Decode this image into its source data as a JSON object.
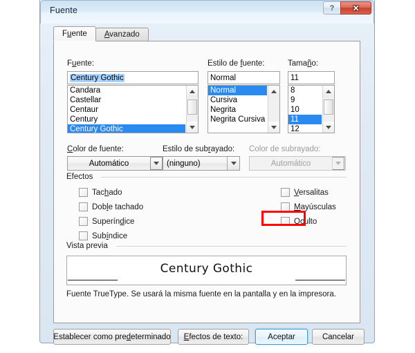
{
  "window": {
    "title": "Fuente",
    "help_button": "?",
    "close_button": "✕"
  },
  "tabs": [
    {
      "label_pre": "F",
      "label_accel": "u",
      "label_post": "ente",
      "active": true
    },
    {
      "label_pre": "",
      "label_accel": "A",
      "label_post": "vanzado",
      "active": false
    }
  ],
  "font_section": {
    "font_label_pre": "F",
    "font_label_accel": "u",
    "font_label_post": "ente:",
    "font_value": "Century Gothic",
    "font_list": [
      "Candara",
      "Castellar",
      "Centaur",
      "Century",
      "Century Gothic"
    ],
    "font_selected": "Century Gothic",
    "style_label_pre": "Estilo de ",
    "style_label_accel": "f",
    "style_label_post": "uente:",
    "style_value": "Normal",
    "style_list": [
      "Normal",
      "Cursiva",
      "Negrita",
      "Negrita Cursiva"
    ],
    "style_selected": "Normal",
    "size_label_pre": "Tama",
    "size_label_accel": "ñ",
    "size_label_post": "o:",
    "size_value": "11",
    "size_list": [
      "8",
      "9",
      "10",
      "11",
      "12"
    ],
    "size_selected": "11"
  },
  "color_row": {
    "font_color_label_pre": "C",
    "font_color_label_accel": "",
    "font_color_label_post": "olor de fuente:",
    "font_color_value": "Automático",
    "underline_style_label_pre": "Estilo de sub",
    "underline_style_label_accel": "r",
    "underline_style_label_post": "ayado:",
    "underline_style_value": "(ninguno)",
    "underline_color_label": "Color de subrayado:",
    "underline_color_value": "Automático",
    "underline_color_disabled": true
  },
  "effects": {
    "group_label": "Efectos",
    "left": [
      {
        "pre": "Tac",
        "accel": "h",
        "post": "ado",
        "checked": false
      },
      {
        "pre": "Dob",
        "accel": "l",
        "post": "e tachado",
        "checked": false
      },
      {
        "pre": "Superín",
        "accel": "d",
        "post": "ice",
        "checked": false
      },
      {
        "pre": "Sub",
        "accel": "í",
        "post": "ndice",
        "checked": false
      }
    ],
    "right": [
      {
        "pre": "",
        "accel": "V",
        "post": "ersalitas",
        "checked": false
      },
      {
        "pre": "",
        "accel": "M",
        "post": "ayúsculas",
        "checked": false
      },
      {
        "pre": "",
        "accel": "O",
        "post": "culto",
        "checked": false,
        "highlighted": true
      }
    ]
  },
  "preview": {
    "group_label": "Vista previa",
    "sample_text": "Century Gothic",
    "note": "Fuente TrueType. Se usará la misma fuente en la pantalla y en la impresora."
  },
  "buttons": [
    {
      "pre": "Establecer como pre",
      "accel": "d",
      "post": "eterminado",
      "default": false
    },
    {
      "pre": "",
      "accel": "E",
      "post": "fectos de texto:",
      "default": false
    },
    {
      "pre": "Aceptar",
      "accel": "",
      "post": "",
      "default": true
    },
    {
      "pre": "Cancelar",
      "accel": "",
      "post": "",
      "default": false
    }
  ],
  "colors": {
    "selection_blue": "#2a8aef",
    "text_selection_blue": "#a8d4ff",
    "annotation_red": "#ff0000",
    "close_red": "#c8412c"
  }
}
